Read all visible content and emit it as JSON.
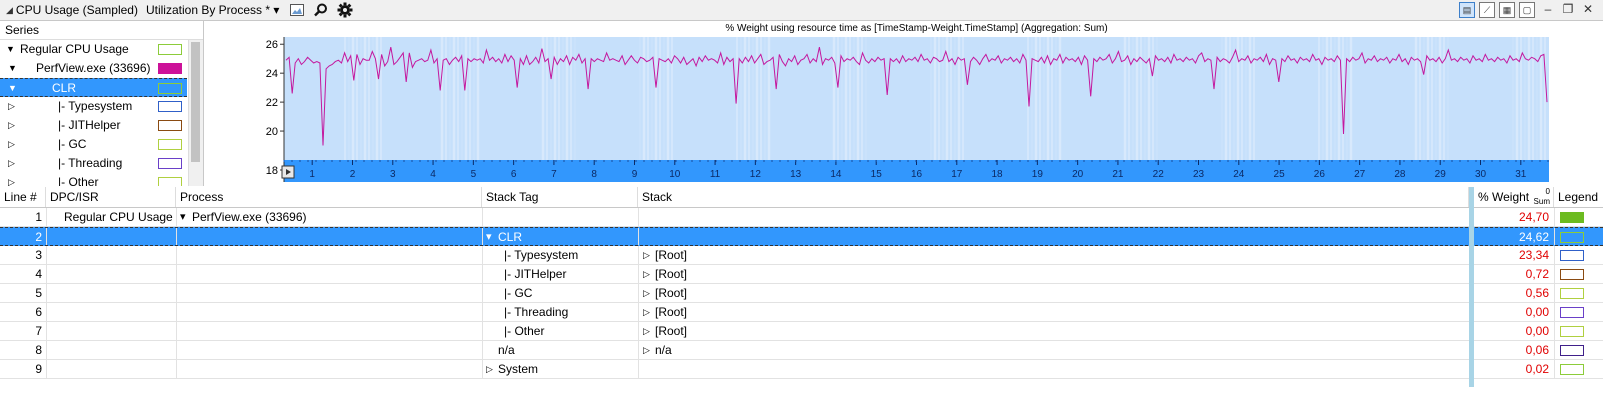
{
  "titlebar": {
    "title": "CPU Usage (Sampled)",
    "preset": "Utilization By Process *",
    "dropdown_glyph": "▾",
    "icons": [
      "collapse-triangle-icon",
      "image-icon",
      "search-icon",
      "gear-icon"
    ],
    "right_icons": [
      "table-chart-view-icon",
      "chart-view-icon",
      "table-view-icon",
      "chart-only-icon",
      "minimize-icon",
      "restore-icon",
      "close-icon"
    ]
  },
  "series": {
    "header": "Series",
    "items": [
      {
        "label": "Regular CPU Usage",
        "expanded": true,
        "color": "#ffffff",
        "border": "#8ccc3a"
      },
      {
        "label": "PerfView.exe (33696)",
        "expanded": true,
        "color": "#cc1199",
        "border": "#cc1199"
      },
      {
        "label": "CLR",
        "expanded": true,
        "color": "#3297fd",
        "border": "#8ccc3a",
        "selected": true
      },
      {
        "label": "|- Typesystem",
        "expanded": false,
        "color": "#ffffff",
        "border": "#3060c8"
      },
      {
        "label": "|- JITHelper",
        "expanded": false,
        "color": "#ffffff",
        "border": "#8a4b12"
      },
      {
        "label": "|- GC",
        "expanded": false,
        "color": "#ffffff",
        "border": "#b0d040"
      },
      {
        "label": "|- Threading",
        "expanded": false,
        "color": "#ffffff",
        "border": "#6a40c8"
      },
      {
        "label": "|- Other",
        "expanded": false,
        "color": "#ffffff",
        "border": "#b0d040"
      }
    ]
  },
  "chart_data": {
    "type": "line",
    "title": "% Weight using resource time as [TimeStamp-Weight.TimeStamp] (Aggregation: Sum)",
    "ylim": [
      18,
      26.5
    ],
    "yticks": [
      18,
      20,
      22,
      24,
      26
    ],
    "xlim": [
      0.3,
      31.7
    ],
    "xticks": [
      1,
      2,
      3,
      4,
      5,
      6,
      7,
      8,
      9,
      10,
      11,
      12,
      13,
      14,
      15,
      16,
      17,
      18,
      19,
      20,
      21,
      22,
      23,
      24,
      25,
      26,
      27,
      28,
      29,
      30,
      31
    ],
    "line_color": "#c4189e",
    "plot_bg": "#c6e0fb",
    "axis_bar_color": "#3297fd",
    "series": [
      {
        "values": [
          24.9,
          25.1,
          22.6,
          24.7,
          25.0,
          24.6,
          24.8,
          25.1,
          24.9,
          24.7,
          24.8,
          24.7,
          19.0,
          24.3,
          24.5,
          24.6,
          24.8,
          24.9,
          24.7,
          25.4,
          24.8,
          25.2,
          23.5,
          25.3,
          24.6,
          25.0,
          24.9,
          24.9,
          25.5,
          25.0,
          23.6,
          25.3,
          24.5,
          24.8,
          25.8,
          24.6,
          24.8,
          25.1,
          25.4,
          23.4,
          25.4,
          24.4,
          24.8,
          24.9,
          25.0,
          24.8,
          24.9,
          25.6,
          24.7,
          25.0,
          22.8,
          24.9,
          25.0,
          24.6,
          24.9,
          25.1,
          24.8,
          25.2,
          22.8,
          25.0,
          24.8,
          25.0,
          24.9,
          25.0,
          24.7,
          25.6,
          24.9,
          25.1,
          24.8,
          25.0,
          24.7,
          25.3,
          24.8,
          25.2,
          24.9,
          23.0,
          25.0,
          24.6,
          25.2,
          24.6,
          24.8,
          25.1,
          24.7,
          25.7,
          24.8,
          25.0,
          23.6,
          25.1,
          24.6,
          25.0,
          24.8,
          25.2,
          24.6,
          25.1,
          24.9,
          25.3,
          24.7,
          25.0,
          22.9,
          25.0,
          24.8,
          25.0,
          24.9,
          24.8,
          25.4,
          24.9,
          25.0,
          24.9,
          24.8,
          25.2,
          24.6,
          24.9,
          25.2,
          24.9,
          24.7,
          25.1,
          25.0,
          24.8,
          24.9,
          25.1,
          23.0,
          25.0,
          24.9,
          24.8,
          25.0,
          24.7,
          25.2,
          25.0,
          24.7,
          25.1,
          24.6,
          24.8,
          25.0,
          24.5,
          25.1,
          24.8,
          25.2,
          24.9,
          25.0,
          24.9,
          24.7,
          25.4,
          24.6,
          25.1,
          24.8,
          25.0,
          21.9,
          25.0,
          24.7,
          25.1,
          24.8,
          25.2,
          24.7,
          25.0,
          25.3,
          24.6,
          24.8,
          24.9,
          25.1,
          22.9,
          25.3,
          24.8,
          24.5,
          25.0,
          24.8,
          25.2,
          24.6,
          24.9,
          25.0,
          25.3,
          24.7,
          25.0,
          24.8,
          25.8,
          24.6,
          25.0,
          24.9,
          25.1,
          24.7,
          23.0,
          25.2,
          24.8,
          25.0,
          24.9,
          25.1,
          24.8,
          24.6,
          25.4,
          24.9,
          24.7,
          25.0,
          24.8,
          25.1,
          24.9,
          25.0,
          22.5,
          25.0,
          24.8,
          25.0,
          24.7,
          25.2,
          24.8,
          25.0,
          24.9,
          25.1,
          24.8,
          25.3,
          24.9,
          25.0,
          24.7,
          25.1,
          25.0,
          24.8,
          24.9,
          25.5,
          24.8,
          25.0,
          24.6,
          25.1,
          24.9,
          25.0,
          23.2,
          24.8,
          25.1,
          24.9,
          24.6,
          25.0,
          25.3,
          24.8,
          25.0,
          24.9,
          25.2,
          24.7,
          25.0,
          24.9,
          25.1,
          24.8,
          25.0,
          24.7,
          25.3,
          24.9,
          21.7,
          25.0,
          24.9,
          24.8,
          25.1,
          24.7,
          25.2,
          24.6,
          25.0,
          24.9,
          25.3,
          24.7,
          25.1,
          24.9,
          25.0,
          24.8,
          25.1,
          24.6,
          25.2,
          24.9,
          22.4,
          25.0,
          24.8,
          25.1,
          24.9,
          25.0,
          25.3,
          24.7,
          25.0,
          25.5,
          24.8,
          24.9,
          25.2,
          24.6,
          25.0,
          24.8,
          25.1,
          24.9,
          24.7,
          25.0,
          23.8,
          25.2,
          24.9,
          25.0,
          24.8,
          25.1,
          24.7,
          25.3,
          24.9,
          25.0,
          24.8,
          25.1,
          24.9,
          25.0,
          24.7,
          25.2,
          25.4,
          24.8,
          25.0,
          24.9,
          22.9,
          25.1,
          24.8,
          25.0,
          24.9,
          24.7,
          25.1,
          25.6,
          24.8,
          25.0,
          24.9,
          25.2,
          24.7,
          25.0,
          24.9,
          25.1,
          24.8,
          25.3,
          24.6,
          25.0,
          24.9,
          23.4,
          25.0,
          24.8,
          25.2,
          24.9,
          25.0,
          24.7,
          25.1,
          24.9,
          25.0,
          24.8,
          25.3,
          24.9,
          25.0,
          24.6,
          25.1,
          24.9,
          25.0,
          24.8,
          25.2,
          24.9,
          19.8,
          25.0,
          24.8,
          25.1,
          24.9,
          25.0,
          25.4,
          24.7,
          25.0,
          24.9,
          25.2,
          24.8,
          25.0,
          24.9,
          25.1,
          24.7,
          25.0,
          24.9,
          25.3,
          24.8,
          25.0,
          24.6,
          25.1,
          24.9,
          25.0,
          24.8,
          23.9,
          25.2,
          24.9,
          25.0,
          24.8,
          25.1,
          24.7,
          25.0,
          25.6,
          24.9,
          25.0,
          24.8,
          25.1,
          24.9,
          25.0,
          24.7,
          25.2,
          24.9,
          25.0,
          24.8,
          25.3,
          24.9,
          25.0,
          24.8,
          25.1,
          24.9,
          25.0,
          24.7,
          25.2,
          24.9,
          25.0,
          24.8,
          25.4,
          25.0,
          24.9,
          25.1,
          25.0,
          24.8,
          25.2,
          25.3,
          22.0
        ]
      }
    ]
  },
  "grid": {
    "columns": [
      "Line #",
      "DPC/ISR",
      "Process",
      "Stack Tag",
      "Stack",
      "% Weight",
      "Legend"
    ],
    "weight_sub": "Sum",
    "weight_sort": "0",
    "rows": [
      {
        "line": "1",
        "dpc": "Regular CPU Usage",
        "process": "PerfView.exe (33696)",
        "process_exp": "▾",
        "tag": "",
        "tag_exp": "",
        "stack": "",
        "stack_exp": "",
        "weight": "24,70",
        "legend_fill": "#6cbb20",
        "legend_border": "#6cbb20"
      },
      {
        "line": "2",
        "dpc": "",
        "process": "",
        "process_exp": "",
        "tag": "CLR",
        "tag_exp": "▾",
        "stack": "",
        "stack_exp": "",
        "weight": "24,62",
        "legend_fill": "#3297fd",
        "legend_border": "#8ccc3a",
        "selected": true
      },
      {
        "line": "3",
        "dpc": "",
        "process": "",
        "process_exp": "",
        "tag": "|- Typesystem",
        "tag_exp": "",
        "stack": "[Root]",
        "stack_exp": "▷",
        "weight": "23,34",
        "legend_fill": "#ffffff",
        "legend_border": "#3060c8"
      },
      {
        "line": "4",
        "dpc": "",
        "process": "",
        "process_exp": "",
        "tag": "|- JITHelper",
        "tag_exp": "",
        "stack": "[Root]",
        "stack_exp": "▷",
        "weight": "0,72",
        "legend_fill": "#ffffff",
        "legend_border": "#8a4b12"
      },
      {
        "line": "5",
        "dpc": "",
        "process": "",
        "process_exp": "",
        "tag": "|- GC",
        "tag_exp": "",
        "stack": "[Root]",
        "stack_exp": "▷",
        "weight": "0,56",
        "legend_fill": "#ffffff",
        "legend_border": "#b0d040"
      },
      {
        "line": "6",
        "dpc": "",
        "process": "",
        "process_exp": "",
        "tag": "|- Threading",
        "tag_exp": "",
        "stack": "[Root]",
        "stack_exp": "▷",
        "weight": "0,00",
        "legend_fill": "#ffffff",
        "legend_border": "#6a40c8"
      },
      {
        "line": "7",
        "dpc": "",
        "process": "",
        "process_exp": "",
        "tag": "|- Other",
        "tag_exp": "",
        "stack": "[Root]",
        "stack_exp": "▷",
        "weight": "0,00",
        "legend_fill": "#ffffff",
        "legend_border": "#b0d040"
      },
      {
        "line": "8",
        "dpc": "",
        "process": "",
        "process_exp": "",
        "tag": "n/a",
        "tag_exp": "",
        "stack": "n/a",
        "stack_exp": "▷",
        "weight": "0,06",
        "legend_fill": "#ffffff",
        "legend_border": "#40208a"
      },
      {
        "line": "9",
        "dpc": "",
        "process": "",
        "process_exp": "",
        "tag": "System",
        "tag_exp": "▷",
        "stack": "",
        "stack_exp": "",
        "weight": "0,02",
        "legend_fill": "#ffffff",
        "legend_border": "#8ccc3a"
      }
    ]
  }
}
